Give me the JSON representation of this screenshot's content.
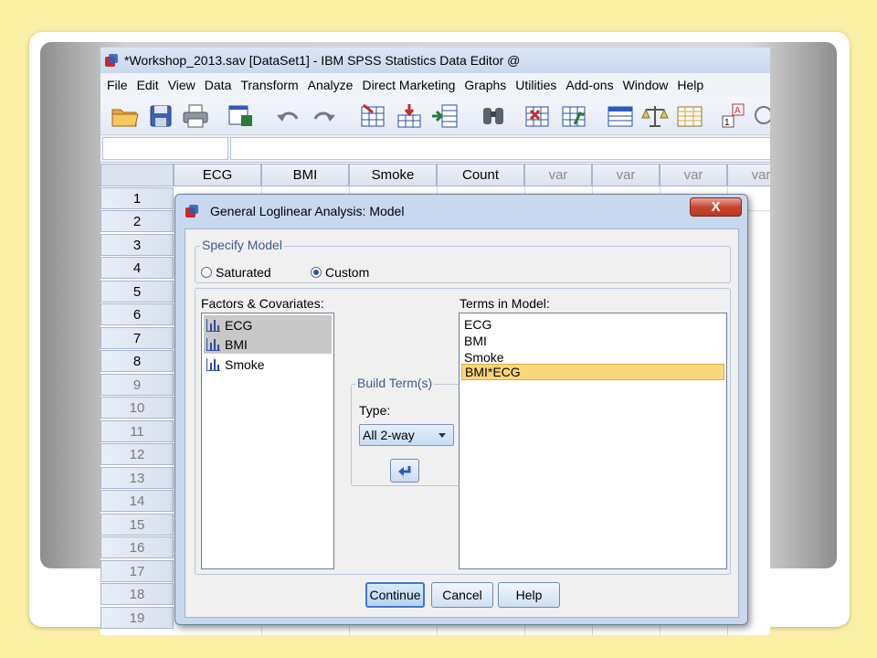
{
  "app": {
    "window_title": "*Workshop_2013.sav [DataSet1] - IBM SPSS Statistics Data Editor @"
  },
  "menu": [
    "File",
    "Edit",
    "View",
    "Data",
    "Transform",
    "Analyze",
    "Direct Marketing",
    "Graphs",
    "Utilities",
    "Add-ons",
    "Window",
    "Help"
  ],
  "toolbar_icons": [
    "open-file-icon",
    "save-icon",
    "print-icon",
    "recall-dialog-icon",
    "undo-icon",
    "redo-icon",
    "goto-case-icon",
    "goto-variable-icon",
    "variables-icon",
    "find-icon",
    "insert-cases-icon",
    "insert-variable-icon",
    "split-file-icon",
    "weight-cases-icon",
    "select-cases-icon",
    "value-labels-icon",
    "use-sets-icon"
  ],
  "grid": {
    "columns": [
      "ECG",
      "BMI",
      "Smoke",
      "Count",
      "var",
      "var",
      "var",
      "var"
    ],
    "rows": [
      "1",
      "2",
      "3",
      "4",
      "5",
      "6",
      "7",
      "8",
      "9",
      "10",
      "11",
      "12",
      "13",
      "14",
      "15",
      "16",
      "17",
      "18",
      "19"
    ]
  },
  "dialog": {
    "title": "General Loglinear Analysis: Model",
    "close_label": "X",
    "specify_model": {
      "label": "Specify Model",
      "options": [
        {
          "label": "Saturated",
          "selected": false
        },
        {
          "label": "Custom",
          "selected": true
        }
      ]
    },
    "factors": {
      "label": "Factors & Covariates:",
      "items": [
        {
          "label": "ECG",
          "selected": true
        },
        {
          "label": "BMI",
          "selected": true
        },
        {
          "label": "Smoke",
          "selected": false
        }
      ]
    },
    "build_term": {
      "label": "Build Term(s)",
      "type_label": "Type:",
      "type_value": "All 2-way"
    },
    "terms": {
      "label": "Terms in Model:",
      "items": [
        {
          "label": "ECG",
          "highlighted": false
        },
        {
          "label": "BMI",
          "highlighted": false
        },
        {
          "label": "Smoke",
          "highlighted": false
        },
        {
          "label": "BMI*ECG",
          "highlighted": true
        }
      ]
    },
    "buttons": {
      "continue": "Continue",
      "cancel": "Cancel",
      "help": "Help"
    }
  },
  "colors": {
    "slide_background": "#fbeea5",
    "dialog_body": "#f0f0f0",
    "dialog_frame": "#c8d8ee",
    "highlight": "#fbd77c",
    "close_button": "#c8462e"
  }
}
